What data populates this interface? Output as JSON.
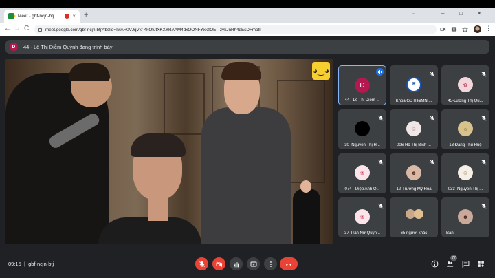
{
  "browser": {
    "tab_title": "Meet - gbf-ncjn-btj",
    "tab_close": "×",
    "new_tab": "+",
    "url": "meet.google.com/gbf-ncjn-btj?fbclid=IwAR0VJqVkf-4kOtutXKXYRAAM4dxOONFYxkzOE_-zykJnRh4dEsDFmoIlI",
    "back": "←",
    "forward": "→",
    "reload": "C",
    "minimize": "–",
    "maximize": "□",
    "close": "✕",
    "menu": "⋮"
  },
  "meet": {
    "presenter": {
      "avatar_letter": "D",
      "text": "44 - Lê Thị Diễm Quỳnh đang trình bày"
    },
    "participants": [
      {
        "name": "44 - Lê Thị Diễm ...",
        "avatar": "D",
        "avatar_color": "#b5174f",
        "speaking": true,
        "muted": false
      },
      {
        "name": "Khoa GDTH&MN ...",
        "avatar": "",
        "avatar_color": "#ffffff",
        "speaking": false,
        "muted": true
      },
      {
        "name": "45-Lương Thị Qu...",
        "avatar": "",
        "avatar_color": "#f3d6dc",
        "speaking": false,
        "muted": true
      },
      {
        "name": "30_Nguyễn Thị H...",
        "avatar": "",
        "avatar_color": "#000000",
        "speaking": false,
        "muted": true
      },
      {
        "name": "006-Hồ Thị Bích ...",
        "avatar": "",
        "avatar_color": "#f0e6e6",
        "speaking": false,
        "muted": true
      },
      {
        "name": "13 Đặng Thu Huệ",
        "avatar": "",
        "avatar_color": "#d6c28a",
        "speaking": false,
        "muted": true
      },
      {
        "name": "074 - Diệp Anh Q...",
        "avatar": "",
        "avatar_color": "#fbe4ea",
        "speaking": false,
        "muted": true
      },
      {
        "name": "12-Trương Mỹ Hoa",
        "avatar": "",
        "avatar_color": "#d9b8a6",
        "speaking": false,
        "muted": true
      },
      {
        "name": "033_Nguyễn Thị ...",
        "avatar": "",
        "avatar_color": "#f5efe6",
        "speaking": false,
        "muted": true
      },
      {
        "name": "37-Trần Nữ Quỳn...",
        "avatar": "",
        "avatar_color": "#fbe4ea",
        "speaking": false,
        "muted": true
      },
      {
        "name": "65 người khác",
        "avatar": "",
        "avatar_color": "#c9a98a",
        "speaking": false,
        "muted": false
      },
      {
        "name": "Bạn",
        "avatar": "",
        "avatar_color": "#caa99a",
        "speaking": false,
        "muted": true
      }
    ],
    "bottom": {
      "time": "09:15",
      "separator": "|",
      "meeting_code": "gbf-ncjn-btj",
      "people_count": "77"
    },
    "colors": {
      "mute_red": "#ea4335",
      "control_grey": "#3c4043",
      "speaking_blue": "#1a73e8"
    }
  }
}
